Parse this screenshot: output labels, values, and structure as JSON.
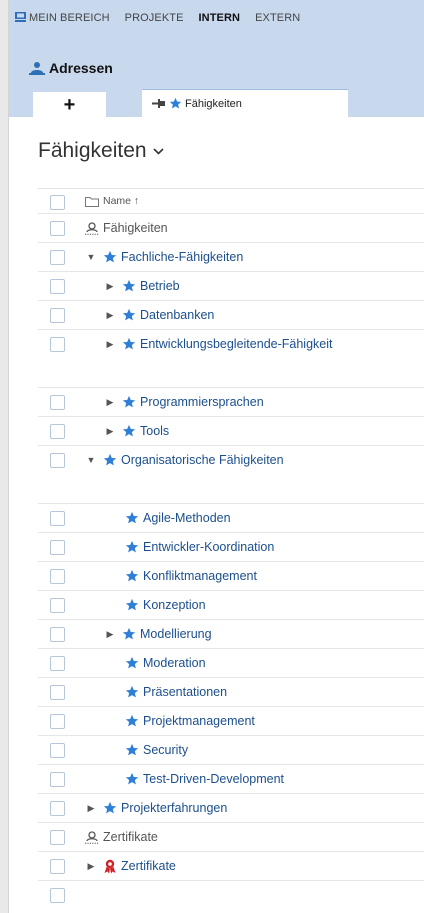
{
  "topnav": {
    "items": [
      {
        "label": "MEIN BEREICH",
        "active": false
      },
      {
        "label": "PROJEKTE",
        "active": false
      },
      {
        "label": "INTERN",
        "active": true
      },
      {
        "label": "EXTERN",
        "active": false
      }
    ]
  },
  "app": {
    "title": "Adressen"
  },
  "tabs": {
    "add_label": "+",
    "active_tab": "Fähigkeiten"
  },
  "page": {
    "title": "Fähigkeiten"
  },
  "grid": {
    "column_header": "Name ↑",
    "rows": [
      {
        "label": "Fähigkeiten",
        "icon": "person-icon"
      },
      {
        "label": "Fachliche-Fähigkeiten",
        "icon": "star-icon",
        "toggle": "expanded"
      },
      {
        "label": "Betrieb",
        "icon": "star-icon",
        "toggle": "collapsed"
      },
      {
        "label": "Datenbanken",
        "icon": "star-icon",
        "toggle": "collapsed"
      },
      {
        "label": "Entwicklungsbegleitende-Fähigkeit",
        "icon": "star-icon",
        "toggle": "collapsed"
      },
      {
        "label": "Programmiersprachen",
        "icon": "star-icon",
        "toggle": "collapsed"
      },
      {
        "label": "Tools",
        "icon": "star-icon",
        "toggle": "collapsed"
      },
      {
        "label": "Organisatorische Fähigkeiten",
        "icon": "star-icon",
        "toggle": "expanded"
      },
      {
        "label": "Agile-Methoden",
        "icon": "star-icon"
      },
      {
        "label": "Entwickler-Koordination",
        "icon": "star-icon"
      },
      {
        "label": "Konfliktmanagement",
        "icon": "star-icon"
      },
      {
        "label": "Konzeption",
        "icon": "star-icon"
      },
      {
        "label": "Modellierung",
        "icon": "star-icon",
        "toggle": "collapsed"
      },
      {
        "label": "Moderation",
        "icon": "star-icon"
      },
      {
        "label": "Präsentationen",
        "icon": "star-icon"
      },
      {
        "label": "Projektmanagement",
        "icon": "star-icon"
      },
      {
        "label": "Security",
        "icon": "star-icon"
      },
      {
        "label": "Test-Driven-Development",
        "icon": "star-icon"
      },
      {
        "label": "Projekterfahrungen",
        "icon": "star-icon",
        "toggle": "collapsed"
      },
      {
        "label": "Zertifikate",
        "icon": "person-icon"
      },
      {
        "label": "Zertifikate",
        "icon": "award-icon",
        "toggle": "collapsed"
      }
    ]
  },
  "colors": {
    "header_bg": "#c8d9ee",
    "link": "#1c4f8f",
    "star": "#2f7fd6",
    "award": "#d0242c"
  }
}
